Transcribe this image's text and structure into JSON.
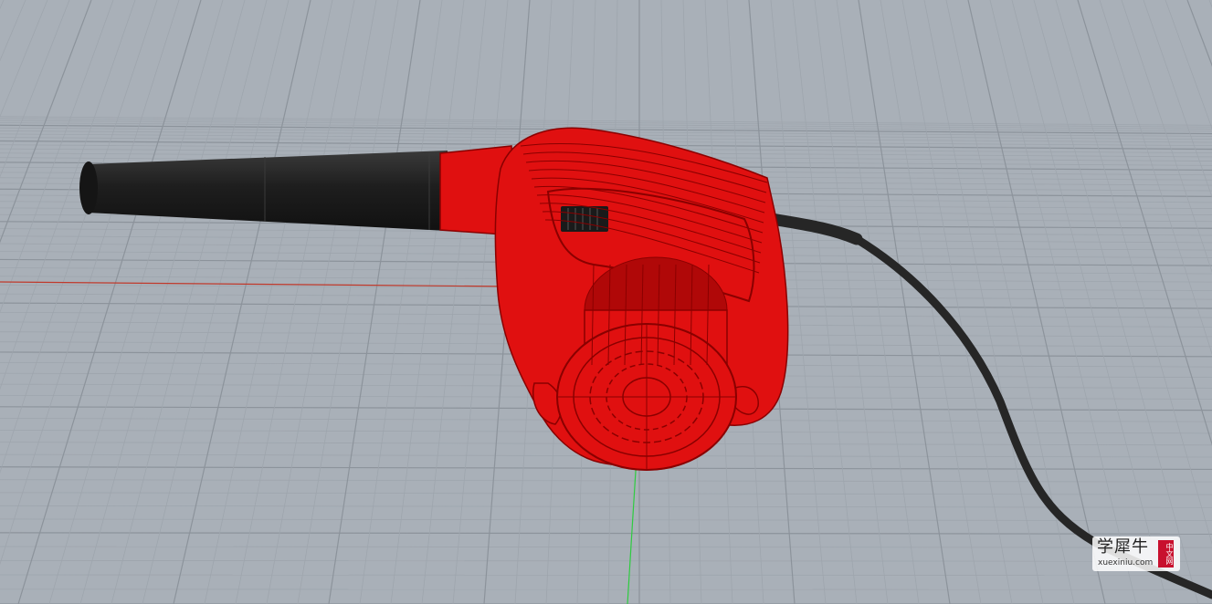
{
  "viewport": {
    "background_color": "#a9b0b8",
    "grid_minor_color": "#9ea5ad",
    "grid_major_color": "#8c939b",
    "x_axis_color": "#c0392b",
    "y_axis_color": "#2ecc40"
  },
  "model": {
    "body_color": "#e01010",
    "wire_color": "#8a0000",
    "nozzle_color": "#222222",
    "cord_color": "#262626"
  },
  "watermark": {
    "chinese_text": "学犀牛",
    "site_text": "xuexiniu.com",
    "stamp_text": "中文网"
  }
}
